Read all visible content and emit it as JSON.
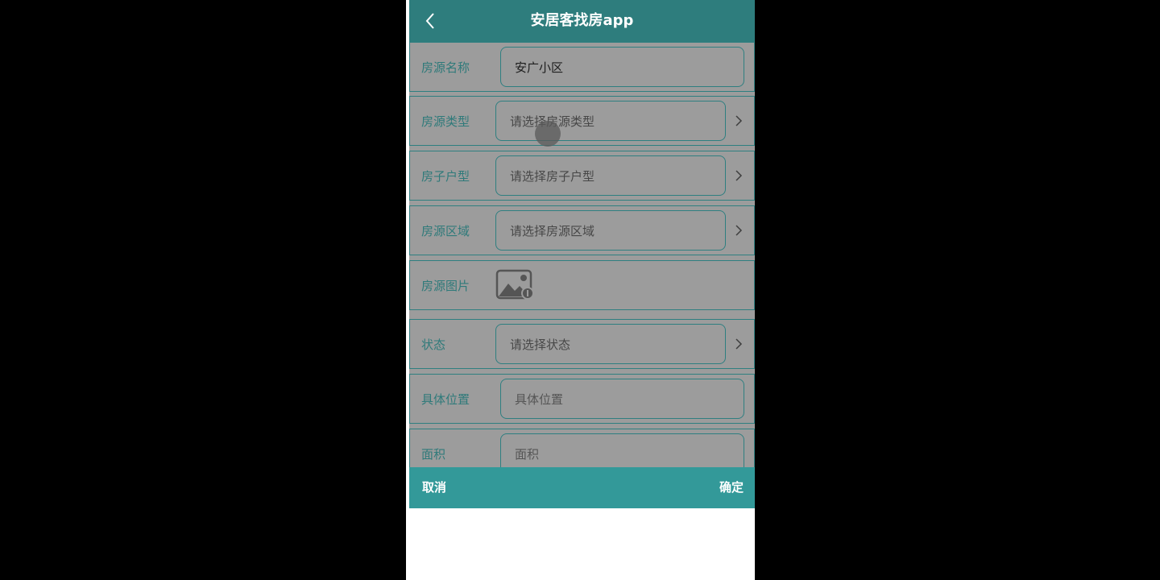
{
  "header": {
    "title": "安居客找房app",
    "back_icon": "chevron-left-icon"
  },
  "form": {
    "name": {
      "label": "房源名称",
      "value": "安广小区"
    },
    "type": {
      "label": "房源类型",
      "placeholder": "请选择房源类型",
      "icon": "chevron-right-icon"
    },
    "layout": {
      "label": "房子户型",
      "placeholder": "请选择房子户型",
      "icon": "chevron-right-icon"
    },
    "area": {
      "label": "房源区域",
      "placeholder": "请选择房源区域",
      "icon": "chevron-right-icon"
    },
    "image": {
      "label": "房源图片",
      "icon": "image-upload-icon"
    },
    "status": {
      "label": "状态",
      "placeholder": "请选择状态",
      "icon": "chevron-right-icon"
    },
    "location": {
      "label": "具体位置",
      "placeholder": "具体位置"
    },
    "size": {
      "label": "面积",
      "placeholder": "面积"
    }
  },
  "actionbar": {
    "cancel": "取消",
    "confirm": "确定"
  },
  "colors": {
    "header": "#2e7d7d",
    "actionbar": "#339999",
    "overlay": "#9c9c9c",
    "accent": "#2f7f80"
  }
}
